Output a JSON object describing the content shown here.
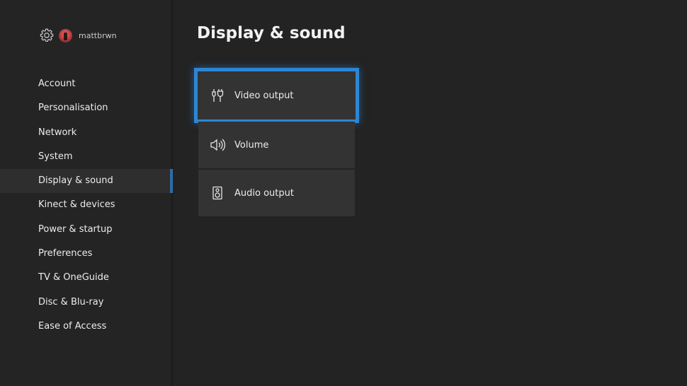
{
  "profile": {
    "username": "mattbrwn"
  },
  "nav": {
    "items": [
      {
        "label": "Account"
      },
      {
        "label": "Personalisation"
      },
      {
        "label": "Network"
      },
      {
        "label": "System"
      },
      {
        "label": "Display & sound",
        "selected": true
      },
      {
        "label": "Kinect & devices"
      },
      {
        "label": "Power & startup"
      },
      {
        "label": "Preferences"
      },
      {
        "label": "TV & OneGuide"
      },
      {
        "label": "Disc & Blu-ray"
      },
      {
        "label": "Ease of Access"
      }
    ]
  },
  "page": {
    "title": "Display & sound"
  },
  "tiles": [
    {
      "label": "Video output",
      "icon": "video-cable-icon",
      "focused": true
    },
    {
      "label": "Volume",
      "icon": "speaker-volume-icon"
    },
    {
      "label": "Audio output",
      "icon": "speaker-box-icon"
    }
  ],
  "colors": {
    "background": "#232323",
    "tile": "#333333",
    "focus_border": "#2d86d4",
    "selected_indicator": "#2f6ba8"
  }
}
